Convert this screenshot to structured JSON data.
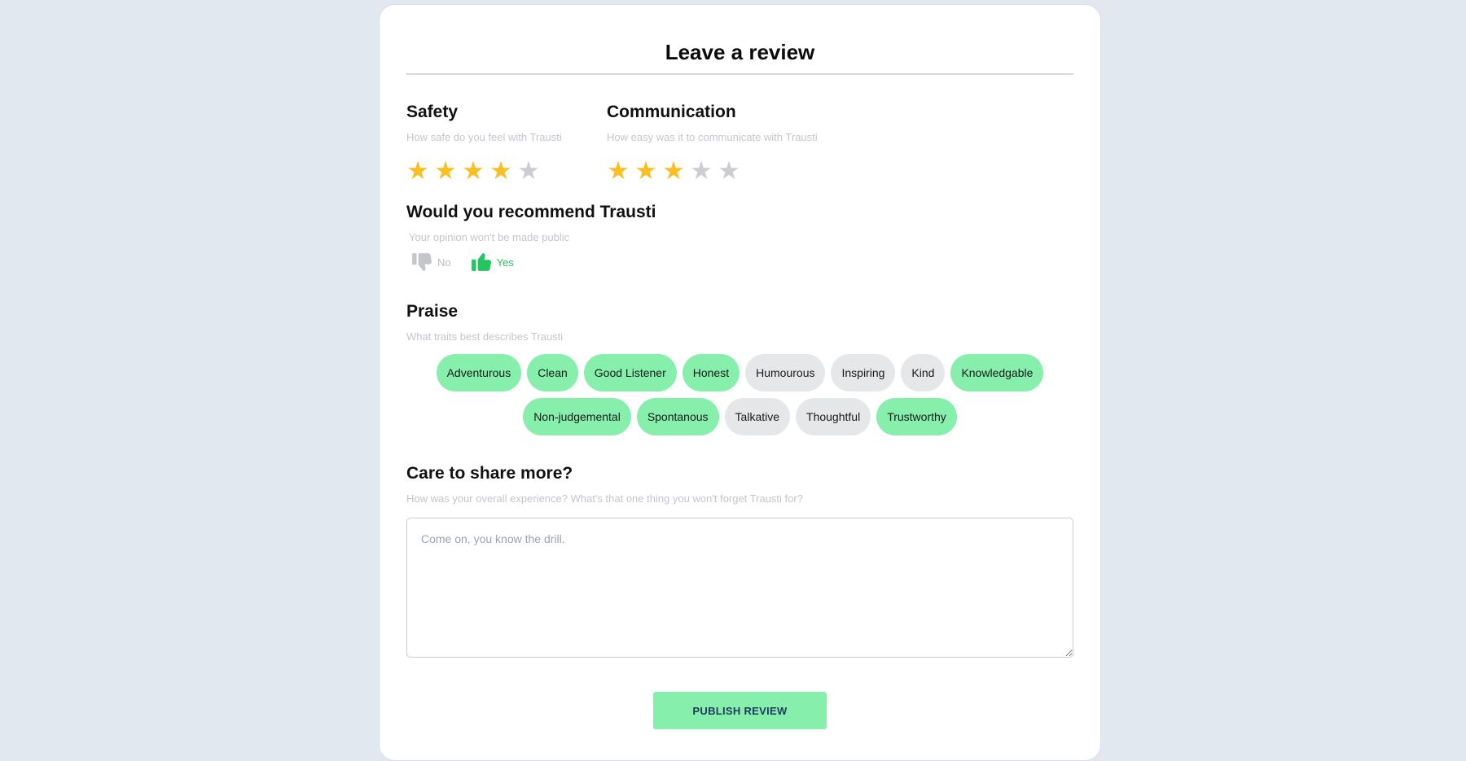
{
  "title": "Leave a review",
  "colors": {
    "star_on": "#fbbf24",
    "star_off": "#cbcdd1",
    "chip_selected": "#86efac",
    "chip_unselected": "#e6e7e9",
    "accent_green": "#22c55e",
    "background": "#e2e8f0"
  },
  "ratings": {
    "safety": {
      "heading": "Safety",
      "subtitle": "How safe do you feel with Trausti",
      "rating": 4,
      "max": 5
    },
    "communication": {
      "heading": "Communication",
      "subtitle": "How easy was it to communicate with Trausti",
      "rating": 3,
      "max": 5
    }
  },
  "recommend": {
    "heading": "Would you recommend Trausti",
    "subtitle": "Your opinion won't be made public",
    "no_label": "No",
    "yes_label": "Yes",
    "selected": "yes",
    "no_icon": "thumbs-down-icon",
    "yes_icon": "thumbs-up-icon"
  },
  "praise": {
    "heading": "Praise",
    "subtitle": "What traits best describes Trausti",
    "traits": [
      {
        "label": "Adventurous",
        "selected": true
      },
      {
        "label": "Clean",
        "selected": true
      },
      {
        "label": "Good Listener",
        "selected": true
      },
      {
        "label": "Honest",
        "selected": true
      },
      {
        "label": "Humourous",
        "selected": false
      },
      {
        "label": "Inspiring",
        "selected": false
      },
      {
        "label": "Kind",
        "selected": false
      },
      {
        "label": "Knowledgable",
        "selected": true
      },
      {
        "label": "Non-judgemental",
        "selected": true
      },
      {
        "label": "Spontanous",
        "selected": true
      },
      {
        "label": "Talkative",
        "selected": false
      },
      {
        "label": "Thoughtful",
        "selected": false
      },
      {
        "label": "Trustworthy",
        "selected": true
      }
    ]
  },
  "share": {
    "heading": "Care to share more?",
    "subtitle": "How was your overall experience? What's that one thing you won't forget Trausti for?",
    "placeholder": "Come on, you know the drill.",
    "value": ""
  },
  "publish_label": "PUBLISH REVIEW"
}
